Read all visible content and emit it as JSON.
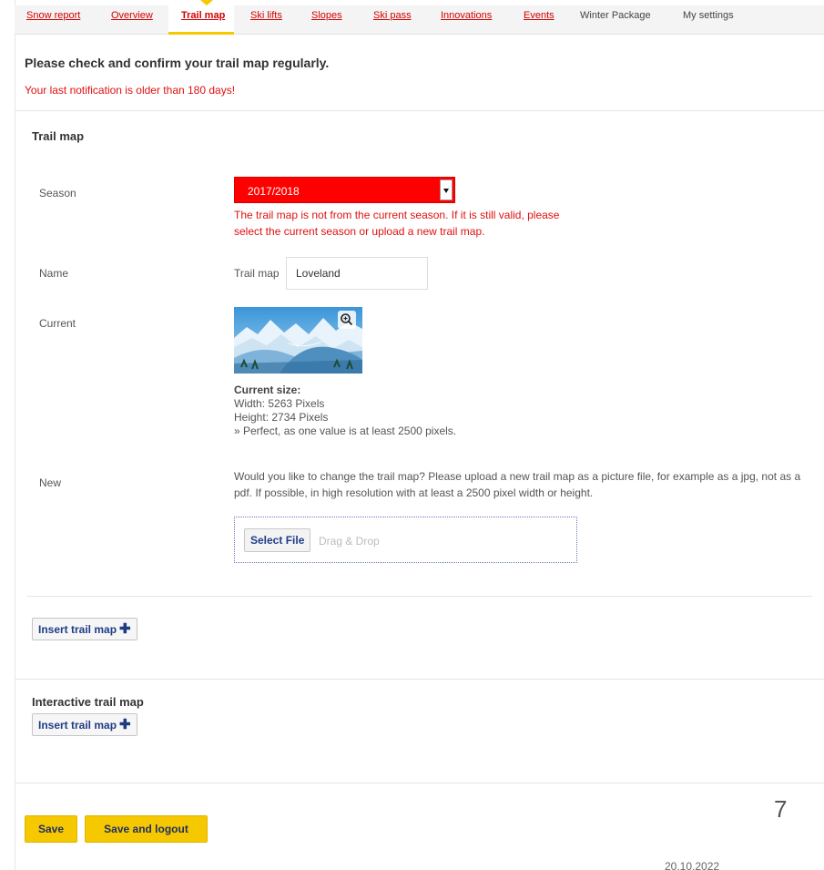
{
  "nav": {
    "items": [
      {
        "label": "Snow report"
      },
      {
        "label": "Overview"
      },
      {
        "label": "Trail map"
      },
      {
        "label": "Ski lifts"
      },
      {
        "label": "Slopes"
      },
      {
        "label": "Ski pass"
      },
      {
        "label": "Innovations"
      },
      {
        "label": "Events"
      },
      {
        "label": "Winter Package"
      },
      {
        "label": "My settings"
      }
    ],
    "active": "Trail map"
  },
  "notice": {
    "heading": "Please check and confirm your trail map regularly.",
    "warning": "Your last notification is older than 180 days!"
  },
  "trail_map": {
    "section_title": "Trail map",
    "season": {
      "label": "Season",
      "value": "2017/2018",
      "error_line1": "The trail map is not from the current season. If it is still valid, please",
      "error_line2": "select the current season or upload a new trail map."
    },
    "name": {
      "label": "Name",
      "prefix": "Trail map",
      "value": "Loveland"
    },
    "current": {
      "label": "Current",
      "size_title": "Current size:",
      "width": "Width: 5263 Pixels",
      "height": "Height: 2734 Pixels",
      "verdict": "» Perfect, as one value is at least 2500 pixels."
    },
    "new": {
      "label": "New",
      "text": "Would you like to change the trail map? Please upload a new trail map as a picture file, for example as a jpg, not as a pdf. If possible, in high resolution with at least a 2500 pixel width or height.",
      "select_file": "Select File",
      "drag_drop": "Drag & Drop"
    },
    "insert_button": "Insert trail map"
  },
  "interactive": {
    "title": "Interactive trail map",
    "insert_button": "Insert trail map"
  },
  "actions": {
    "save": "Save",
    "save_logout": "Save and logout"
  },
  "slide": {
    "page_number": "7",
    "date": "20.10.2022"
  },
  "colors": {
    "accent": "#f6c800",
    "link_red": "#d40000",
    "error_red": "#e01010",
    "select_red": "#ff0000",
    "button_text": "#1f3c86"
  },
  "icons": {
    "zoom": "zoom-in-icon",
    "plus": "plus-icon",
    "dropdown": "chevron-down-icon"
  }
}
